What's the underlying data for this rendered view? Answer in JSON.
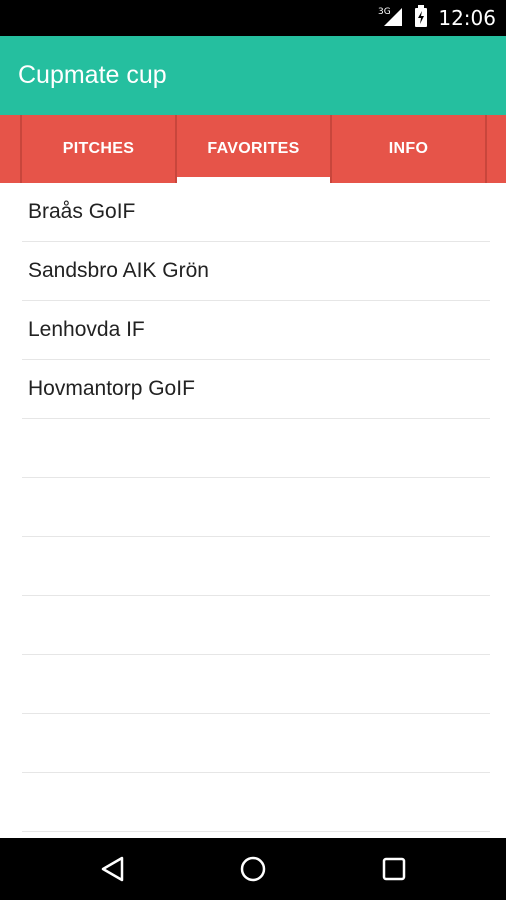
{
  "status_bar": {
    "network": "3G",
    "time": "12:06"
  },
  "app_bar": {
    "title": "Cupmate cup"
  },
  "tabs": [
    {
      "label": "PITCHES",
      "active": false
    },
    {
      "label": "FAVORITES",
      "active": true
    },
    {
      "label": "INFO",
      "active": false
    }
  ],
  "favorites": [
    "Braås GoIF",
    "Sandsbro AIK Grön",
    "Lenhovda IF",
    "Hovmantorp GoIF",
    "",
    "",
    "",
    "",
    "",
    "",
    ""
  ],
  "colors": {
    "app_bar": "#25bf9f",
    "tabs": "#e65449",
    "indicator": "#ffffff"
  },
  "nav": {
    "back": "back-icon",
    "home": "home-icon",
    "recents": "recents-icon"
  }
}
